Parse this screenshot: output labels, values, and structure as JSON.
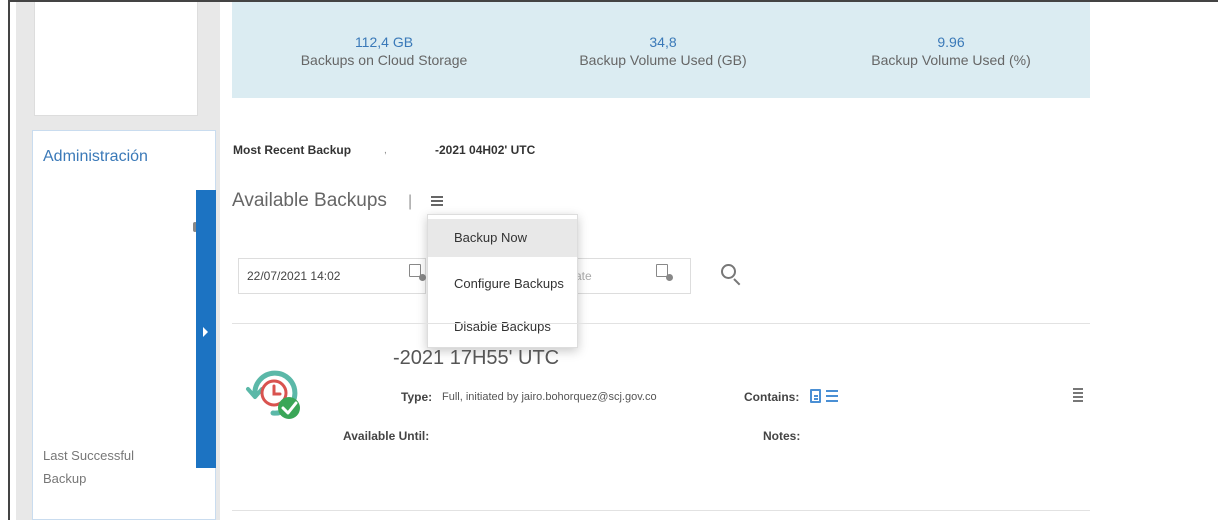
{
  "sidebar": {
    "admin_title": "Administración",
    "last_backup_label": "Last Successful Backup"
  },
  "stats": [
    {
      "value": "112,4 GB",
      "label": "Backups on Cloud Storage"
    },
    {
      "value": "34,8",
      "label": "Backup Volume Used (GB)"
    },
    {
      "value": "9.96",
      "label": "Backup Volume Used (%)"
    }
  ],
  "recent": {
    "label": "Most Recent Backup",
    "comma": ",",
    "value": "-2021 04H02' UTC"
  },
  "backups": {
    "title": "Available Backups",
    "separator": "|",
    "menu": [
      "Backup Now",
      "Configure Backups",
      "Disable Backups"
    ],
    "from_date_value": "22/07/2021 14:02",
    "to_date_placeholder": "ate"
  },
  "backup_item": {
    "title": "-2021 17H55' UTC",
    "type_label": "Type:",
    "type_value": "Full, initiated by jairo.bohorquez@scj.gov.co",
    "contains_label": "Contains:",
    "available_until_label": "Available Until:",
    "notes_label": "Notes:"
  },
  "colors": {
    "accent_blue": "#1c73c2",
    "stats_bg": "#dbecf2",
    "link_blue": "#3a79b8",
    "success_green": "#3aa657",
    "clock_red": "#d9534f",
    "restore_teal": "#5bb8a8"
  },
  "icons": {
    "menu": "hamburger-menu-icon",
    "calendar": "calendar-icon",
    "search": "search-icon",
    "backup_status": "backup-success-icon",
    "file": "file-icon",
    "list": "list-icon"
  }
}
